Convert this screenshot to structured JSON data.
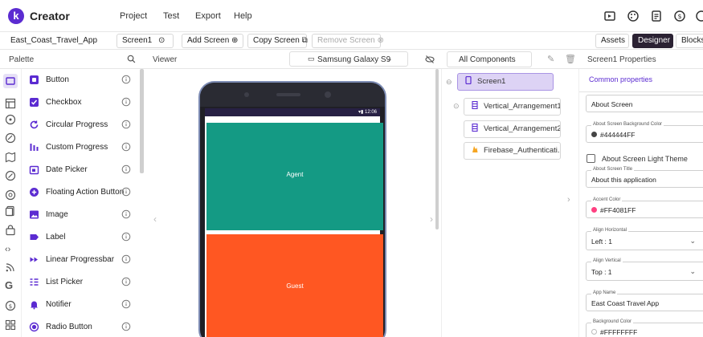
{
  "app": {
    "logo_letter": "k",
    "name": "Creator"
  },
  "menu": [
    "Project",
    "Test",
    "Export",
    "Help"
  ],
  "toolbar": {
    "project_name": "East_Coast_Travel_App",
    "screen_selector": "Screen1",
    "add_screen": "Add Screen",
    "copy_screen": "Copy Screen",
    "remove_screen": "Remove Screen",
    "assets": "Assets",
    "designer": "Designer",
    "blocks": "Blocks"
  },
  "panels": {
    "palette": "Palette",
    "viewer": "Viewer",
    "device": "Samsung Galaxy S9",
    "components_filter": "All Components",
    "properties_title": "Screen1 Properties",
    "properties_tab": "Common properties"
  },
  "palette_items": [
    "Button",
    "Checkbox",
    "Circular Progress",
    "Custom Progress",
    "Date Picker",
    "Floating Action Button",
    "Image",
    "Label",
    "Linear Progressbar",
    "List Picker",
    "Notifier",
    "Radio Button"
  ],
  "phone": {
    "status_text": "12:06",
    "arrangement1_text": "Agent",
    "arrangement2_text": "Guest",
    "arrangement1_color": "#149a84",
    "arrangement2_color": "#ff5722"
  },
  "tree": [
    "Screen1",
    "Vertical_Arrangement1",
    "Vertical_Arrangement2",
    "Firebase_Authenticati..."
  ],
  "properties": {
    "about_screen_placeholder": "About Screen",
    "bg_color_label": "About Screen Background Color",
    "bg_color_value": "#444444FF",
    "light_theme_label": "About Screen Light Theme",
    "title_label": "About Screen Title",
    "title_value": "About this application",
    "accent_label": "Accent Color",
    "accent_value": "#FF4081FF",
    "align_h_label": "Align Horizontal",
    "align_h_value": "Left : 1",
    "align_v_label": "Align Vertical",
    "align_v_value": "Top : 1",
    "appname_label": "App Name",
    "appname_value": "East Coast Travel App",
    "bgcolor2_label": "Background Color",
    "bgcolor2_value": "#FFFFFFFF"
  },
  "colors": {
    "brand": "#5b2bd1",
    "accent_swatch": "#ff4081",
    "dark_swatch": "#444444",
    "selected_node": "#ddd3f5"
  }
}
